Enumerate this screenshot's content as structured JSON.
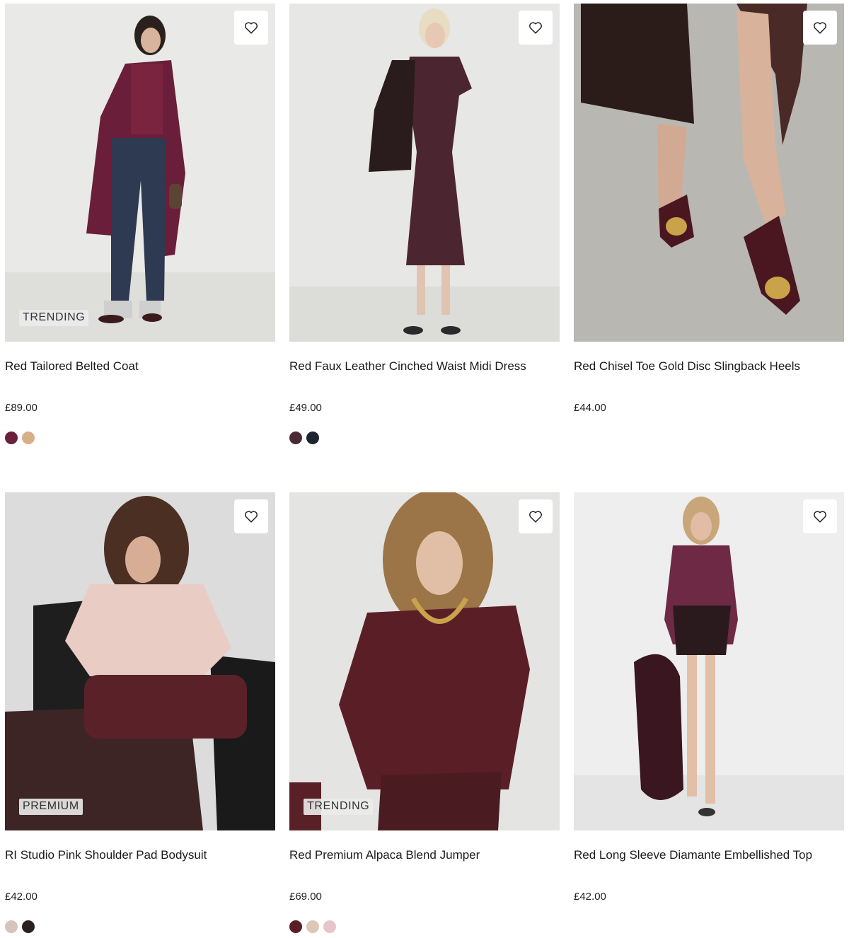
{
  "products": [
    {
      "name": "Red Tailored Belted Coat",
      "price": "£89.00",
      "badge": "TRENDING",
      "image_icon": "product-photo-coat",
      "swatches": [
        "#6a1f3a",
        "#d8b087"
      ]
    },
    {
      "name": "Red Faux Leather Cinched Waist Midi Dress",
      "price": "£49.00",
      "badge": "",
      "image_icon": "product-photo-dress",
      "swatches": [
        "#4a2a35",
        "#1c2430"
      ]
    },
    {
      "name": "Red Chisel Toe Gold Disc Slingback Heels",
      "price": "£44.00",
      "badge": "",
      "image_icon": "product-photo-heels",
      "swatches": []
    },
    {
      "name": "RI Studio Pink Shoulder Pad Bodysuit",
      "price": "£42.00",
      "badge": "PREMIUM",
      "image_icon": "product-photo-bodysuit",
      "swatches": [
        "#d6c3bb",
        "#2b2020"
      ]
    },
    {
      "name": "Red Premium Alpaca Blend Jumper",
      "price": "£69.00",
      "badge": "TRENDING",
      "image_icon": "product-photo-jumper",
      "swatches": [
        "#5a1e24",
        "#dcc7b6",
        "#e6c6c8"
      ]
    },
    {
      "name": "Red Long Sleeve Diamante Embellished Top",
      "price": "£42.00",
      "badge": "",
      "image_icon": "product-photo-top",
      "swatches": []
    }
  ],
  "wishlist_icon": "heart-outline-icon",
  "colors": {
    "accent_burgundy": "#5a1e2c",
    "text": "#1a1a1a"
  }
}
